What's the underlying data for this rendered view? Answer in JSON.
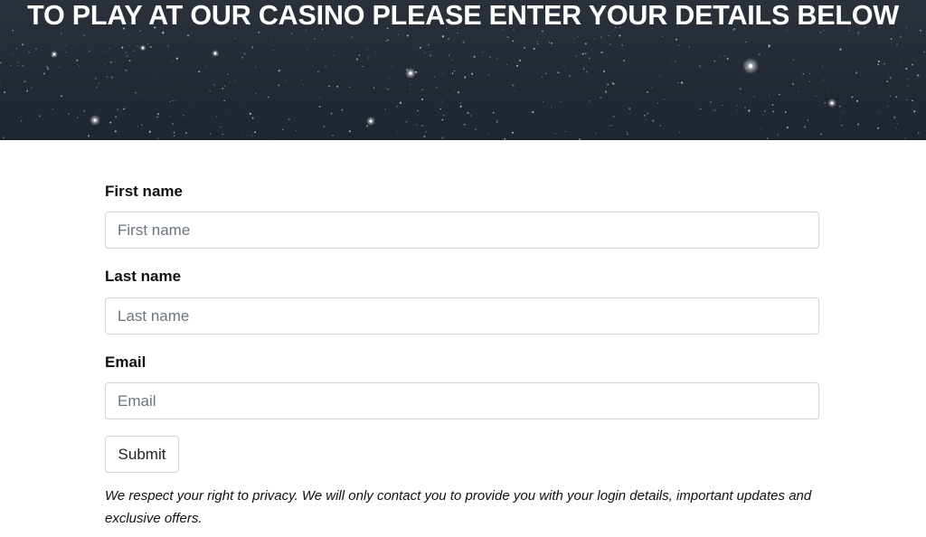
{
  "hero": {
    "title": "TO PLAY AT OUR CASINO PLEASE ENTER YOUR DETAILS BELOW"
  },
  "form": {
    "first_name": {
      "label": "First name",
      "placeholder": "First name",
      "value": ""
    },
    "last_name": {
      "label": "Last name",
      "placeholder": "Last name",
      "value": ""
    },
    "email": {
      "label": "Email",
      "placeholder": "Email",
      "value": ""
    },
    "submit_label": "Submit",
    "privacy_text": "We respect your right to privacy. We will only contact you to provide you with your login details, important updates and exclusive offers."
  },
  "colors": {
    "hero_background": "#232a33",
    "hero_text": "#ffffff",
    "input_border": "#ced4da",
    "placeholder_text": "#6c757d",
    "label_text": "#111111"
  }
}
